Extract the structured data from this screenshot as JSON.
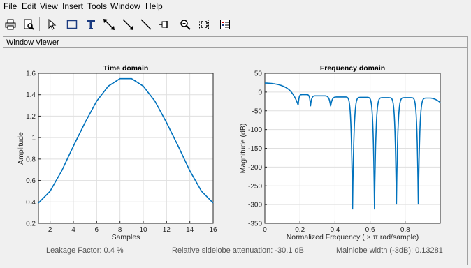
{
  "menu": [
    "File",
    "Edit",
    "View",
    "Insert",
    "Tools",
    "Window",
    "Help"
  ],
  "toolbar_icons": [
    "print-icon",
    "print-preview-icon",
    "pointer-icon",
    "insert-rectangle-icon",
    "insert-text-icon",
    "insert-double-arrow-icon",
    "insert-arrow-icon",
    "insert-line-icon",
    "data-cursor-icon",
    "zoom-in-icon",
    "fit-icon",
    "legend-icon"
  ],
  "panel_title": "Window Viewer",
  "footer": {
    "leakage": "Leakage Factor: 0.4 %",
    "sidelobe": "Relative sidelobe attenuation: -30.1 dB",
    "mainlobe": "Mainlobe width (-3dB): 0.13281"
  },
  "chart_data": [
    {
      "type": "line",
      "title": "Time domain",
      "xlabel": "Samples",
      "ylabel": "Amplitude",
      "xlim": [
        1,
        16
      ],
      "ylim": [
        0.2,
        1.6
      ],
      "xticks": [
        "2",
        "4",
        "6",
        "8",
        "10",
        "12",
        "14",
        "16"
      ],
      "yticks": [
        "0.2",
        "0.4",
        "0.6",
        "0.8",
        "1",
        "1.2",
        "1.4",
        "1.6"
      ],
      "x": [
        1,
        2,
        3,
        4,
        5,
        6,
        7,
        8,
        9,
        10,
        11,
        12,
        13,
        14,
        15,
        16
      ],
      "y": [
        0.39,
        0.5,
        0.69,
        0.92,
        1.14,
        1.34,
        1.48,
        1.55,
        1.55,
        1.48,
        1.34,
        1.14,
        0.92,
        0.69,
        0.5,
        0.39
      ],
      "color": "#0072bd"
    },
    {
      "type": "line",
      "title": "Frequency domain",
      "xlabel": "Normalized  Frequency    ( × π  rad/sample)",
      "ylabel": "Magnitude (dB)",
      "xlim": [
        0,
        1
      ],
      "ylim": [
        -350,
        50
      ],
      "xticks": [
        "0",
        "0.2",
        "0.4",
        "0.6",
        "0.8"
      ],
      "yticks": [
        "50",
        "0",
        "-50",
        "-100",
        "-150",
        "-200",
        "-250",
        "-300",
        "-350"
      ],
      "mainlobe_peak": 23.8,
      "nulls": [
        {
          "x": 0.19,
          "y": -35
        },
        {
          "x": 0.26,
          "y": -38
        },
        {
          "x": 0.375,
          "y": -38
        },
        {
          "x": 0.5,
          "y": -313
        },
        {
          "x": 0.625,
          "y": -313
        },
        {
          "x": 0.75,
          "y": -300
        },
        {
          "x": 0.875,
          "y": -300
        }
      ],
      "sidelobe_peaks": [
        {
          "x": 0.225,
          "y": -7
        },
        {
          "x": 0.31,
          "y": -10
        },
        {
          "x": 0.44,
          "y": -13
        },
        {
          "x": 0.565,
          "y": -14
        },
        {
          "x": 0.69,
          "y": -15
        },
        {
          "x": 0.815,
          "y": -15
        },
        {
          "x": 0.94,
          "y": -16
        }
      ],
      "end_value": -28,
      "color": "#0072bd"
    }
  ]
}
